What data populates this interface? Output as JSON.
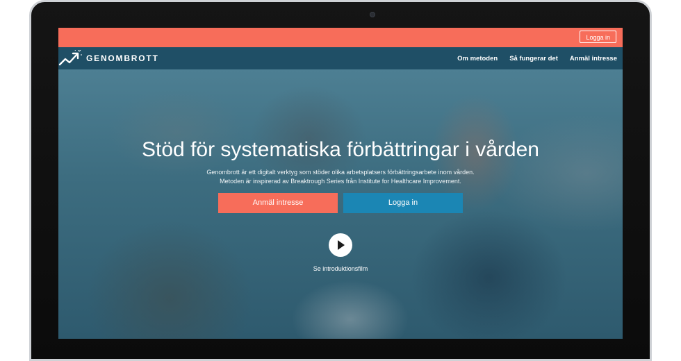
{
  "topbar": {
    "login_label": "Logga in"
  },
  "brand": {
    "name": "GENOMBROTT"
  },
  "nav": {
    "items": [
      {
        "label": "Om metoden"
      },
      {
        "label": "Så fungerar det"
      },
      {
        "label": "Anmäl intresse"
      }
    ]
  },
  "hero": {
    "title": "Stöd för systematiska förbättringar i vården",
    "description": "Genombrott är ett digitalt verktyg som stöder olika arbetsplatsers förbättringsarbete inom vården. Metoden är inspirerad av Breaktrough Series från Institute for Healthcare Improvement.",
    "primary_button": "Anmäl intresse",
    "secondary_button": "Logga in",
    "video_label": "Se introduktionsfilm"
  },
  "colors": {
    "accent_coral": "#f76d5a",
    "nav_blue": "#1f4f66",
    "button_blue": "#1b86b4"
  },
  "icons": {
    "logo": "growth-arrow-icon",
    "video": "play-icon"
  }
}
